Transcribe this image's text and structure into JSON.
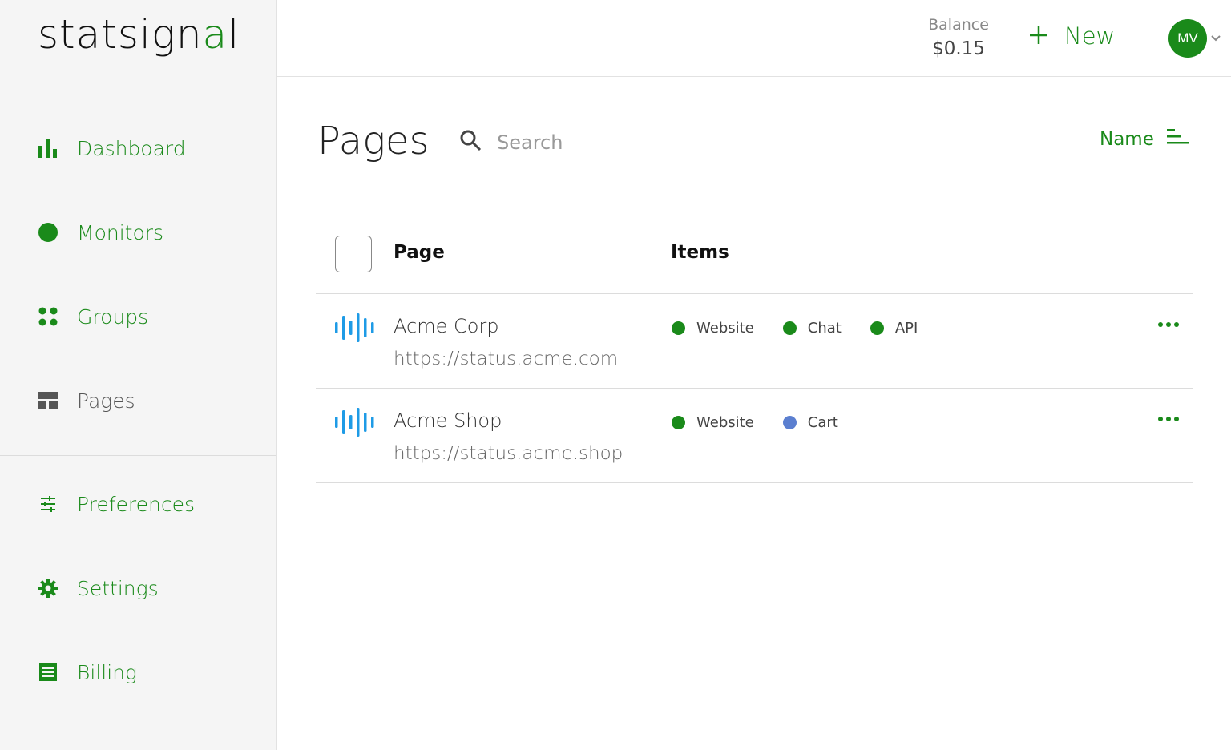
{
  "brand": {
    "name_pre": "statsign",
    "name_mid": "a",
    "name_post": "l"
  },
  "sidebar": {
    "items": [
      {
        "label": "Dashboard",
        "icon": "bar-chart-icon"
      },
      {
        "label": "Monitors",
        "icon": "circle-icon"
      },
      {
        "label": "Groups",
        "icon": "dots-grid-icon"
      },
      {
        "label": "Pages",
        "icon": "layout-icon"
      },
      {
        "label": "Preferences",
        "icon": "sliders-icon"
      },
      {
        "label": "Settings",
        "icon": "gear-icon"
      },
      {
        "label": "Billing",
        "icon": "receipt-icon"
      }
    ]
  },
  "header": {
    "balance_label": "Balance",
    "balance_value": "$0.15",
    "new_label": "New",
    "user_initials": "MV"
  },
  "main": {
    "title": "Pages",
    "search_placeholder": "Search",
    "sort_label": "Name",
    "columns": {
      "page": "Page",
      "items": "Items"
    },
    "rows": [
      {
        "name": "Acme Corp",
        "url": "https://status.acme.com",
        "items": [
          {
            "label": "Website",
            "status": "up"
          },
          {
            "label": "Chat",
            "status": "up"
          },
          {
            "label": "API",
            "status": "up"
          }
        ]
      },
      {
        "name": "Acme Shop",
        "url": "https://status.acme.shop",
        "items": [
          {
            "label": "Website",
            "status": "up"
          },
          {
            "label": "Cart",
            "status": "paused"
          }
        ]
      }
    ]
  },
  "colors": {
    "accent": "#1a8a1a",
    "up": "#1a8a1a",
    "paused": "#5b7fd0",
    "page_icon": "#1e9be6"
  }
}
